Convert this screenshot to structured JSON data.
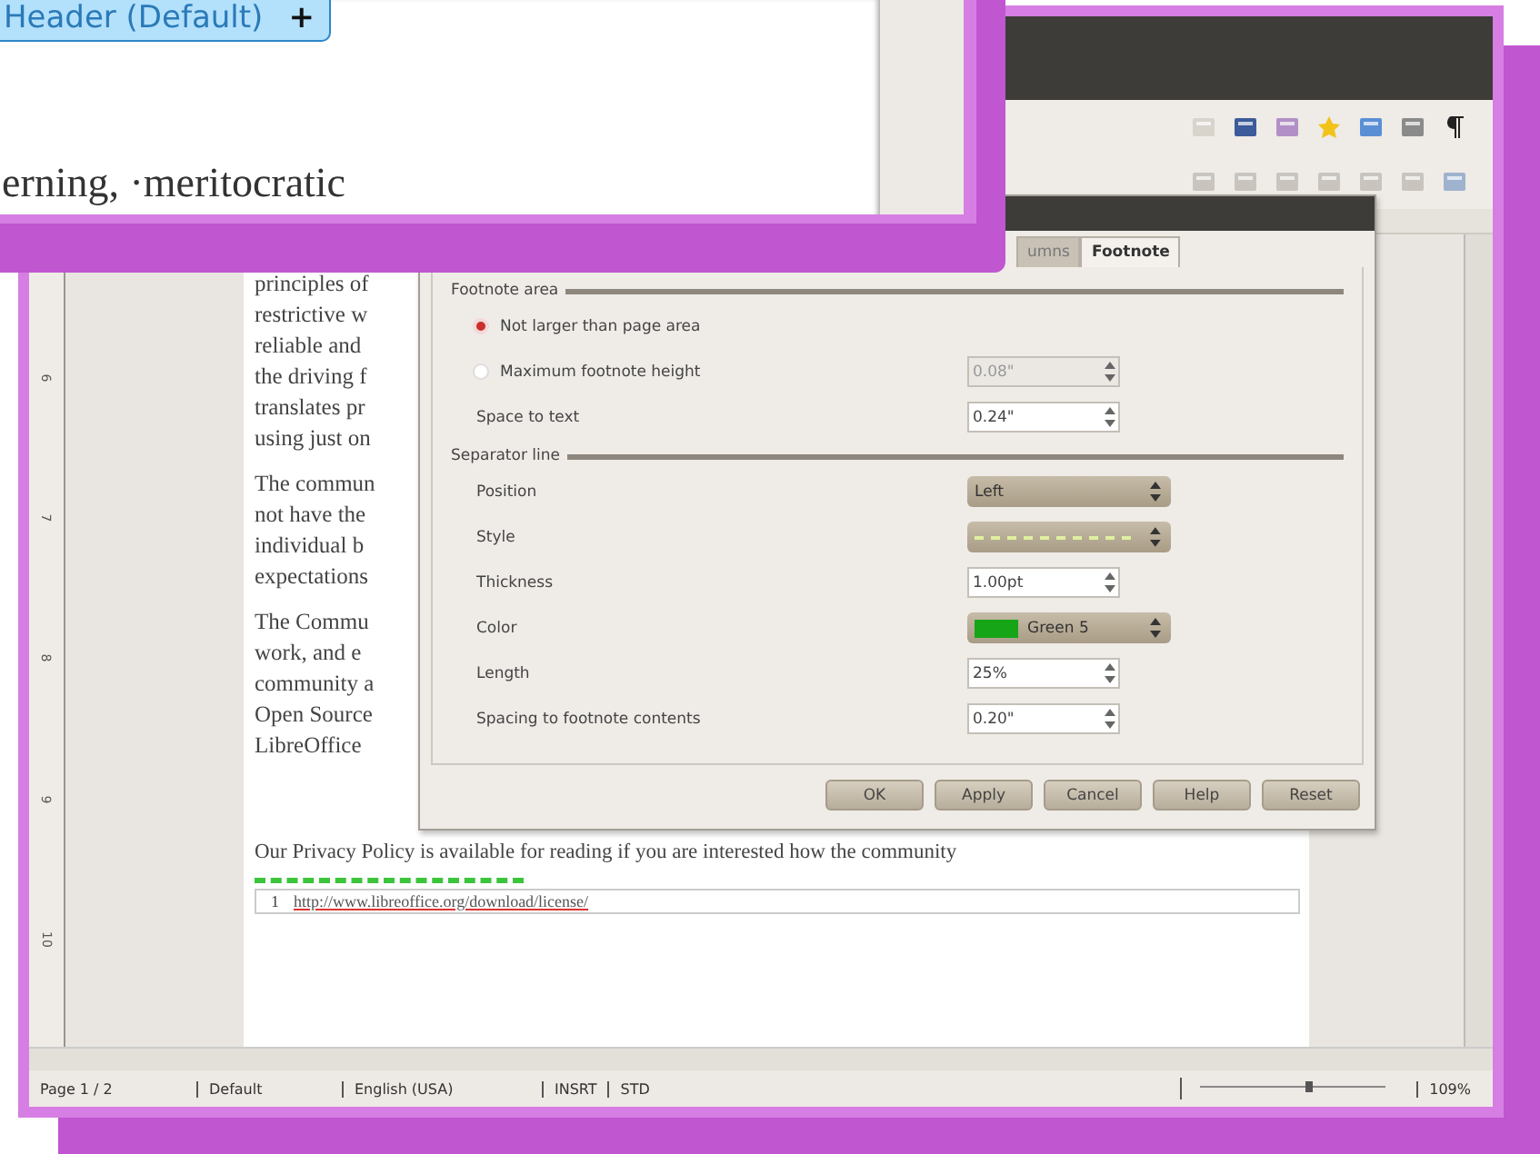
{
  "inset": {
    "header_button": "Header (Default)",
    "header_button_icon": "+",
    "text": "erning, ·meritocratic"
  },
  "ruler": {
    "marks": [
      "6",
      "7",
      "8",
      "9",
      "10"
    ]
  },
  "document": {
    "paragraphs": [
      [
        "principles of",
        "restrictive w",
        "reliable and",
        "the driving f",
        "translates pr",
        "using just on"
      ],
      [
        "The commun",
        "not have the",
        "individual b",
        "expectations"
      ],
      [
        "The Commu",
        "work, and e",
        "community a",
        "Open Source",
        "LibreOffice"
      ]
    ],
    "trailing_line": "Our Privacy Policy is available for reading if you are interested how the community",
    "footnote": {
      "number": "1",
      "url": "http://www.libreoffice.org/download/license/"
    }
  },
  "dialog": {
    "tabs": [
      {
        "label": "umns",
        "selected": false
      },
      {
        "label": "Footnote",
        "selected": true
      }
    ],
    "sections": [
      {
        "title": "Footnote area",
        "rows": [
          {
            "kind": "radio",
            "label": "Not larger than page area",
            "selected": true
          },
          {
            "kind": "radio",
            "label": "Maximum footnote height",
            "selected": false,
            "value": "0.08\"",
            "disabled": true
          },
          {
            "kind": "spin",
            "label": "Space to text",
            "value": "0.24\"",
            "disabled": false
          }
        ]
      },
      {
        "title": "Separator line",
        "rows": [
          {
            "kind": "dropdown",
            "label": "Position",
            "value": "Left"
          },
          {
            "kind": "style",
            "label": "Style"
          },
          {
            "kind": "spin",
            "label": "Thickness",
            "value": "1.00pt",
            "disabled": false
          },
          {
            "kind": "color",
            "label": "Color",
            "value": "Green 5",
            "color": "#16a516"
          },
          {
            "kind": "spin",
            "label": "Length",
            "value": "25%",
            "disabled": false
          },
          {
            "kind": "spin",
            "label": "Spacing to footnote contents",
            "value": "0.20\"",
            "disabled": false
          }
        ]
      }
    ],
    "buttons": [
      "OK",
      "Apply",
      "Cancel",
      "Help",
      "Reset"
    ]
  },
  "status_bar": {
    "page": "Page 1 / 2",
    "style": "Default",
    "language": "English (USA)",
    "mode": "INSRT",
    "selection": "STD",
    "zoom": "109%",
    "zoom_slider": {
      "level": 0.6
    }
  }
}
